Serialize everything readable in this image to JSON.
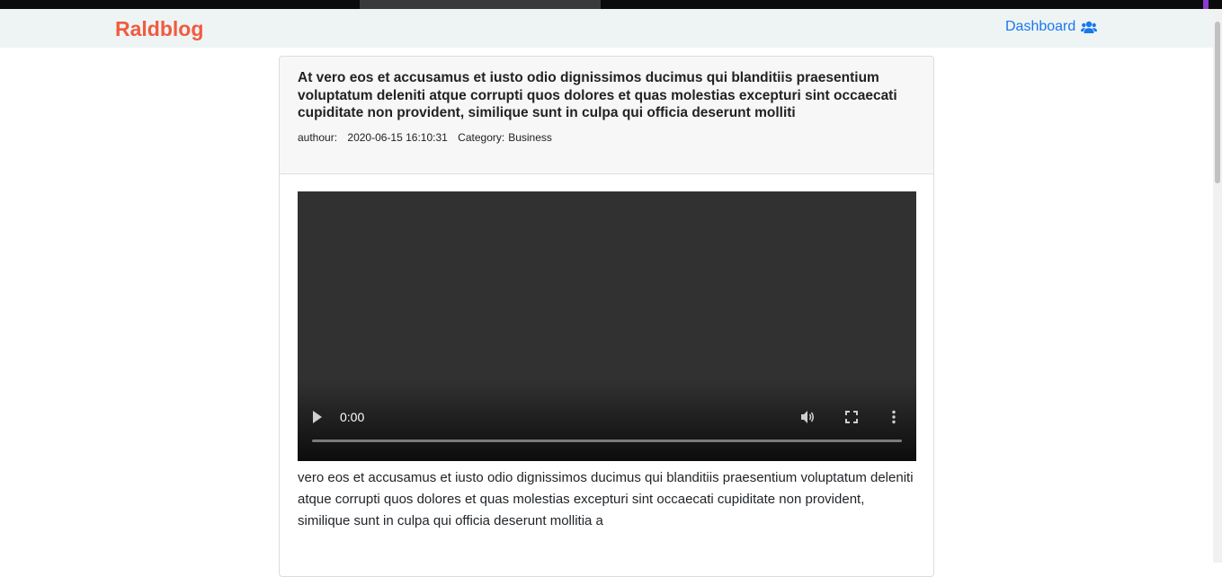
{
  "navbar": {
    "brand": "Raldblog",
    "dashboard_label": "Dashboard",
    "dashboard_icon": "users-icon",
    "background": "#eef4f4",
    "brand_color": "#f05b40",
    "link_color": "#1877f2"
  },
  "post": {
    "title": "At vero eos et accusamus et iusto odio dignissimos ducimus qui blanditiis praesentium voluptatum deleniti atque corrupti quos dolores et quas molestias excepturi sint occaecati cupiditate non provident, similique sunt in culpa qui officia deserunt molliti",
    "author_label": "authour:",
    "date": "2020-06-15 16:10:31",
    "category_label": "Category:",
    "category": "Business",
    "video": {
      "time": "0:00",
      "progress": 0,
      "icons": [
        "play-icon",
        "volume-icon",
        "fullscreen-icon",
        "more-options-icon"
      ]
    },
    "body": "vero eos et accusamus et iusto odio dignissimos ducimus qui blanditiis praesentium voluptatum deleniti atque corrupti quos dolores et quas molestias excepturi sint occaecati cupiditate non provident, similique sunt in culpa qui officia deserunt mollitia a"
  }
}
